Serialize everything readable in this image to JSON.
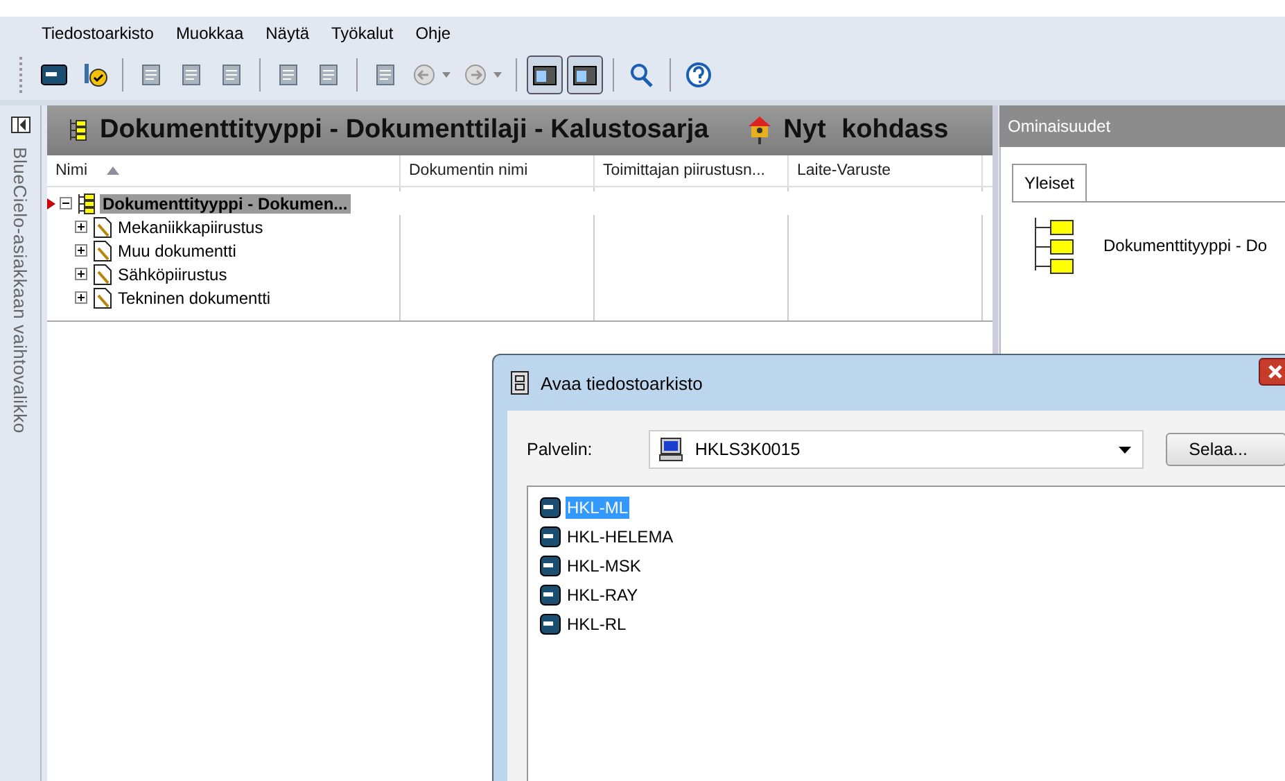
{
  "menu": [
    "Tiedostoarkisto",
    "Muokkaa",
    "Näytä",
    "Työkalut",
    "Ohje"
  ],
  "toolbar": [
    [
      {
        "pressed": false,
        "dropdown": false
      },
      {
        "pressed": false,
        "dropdown": false
      }
    ],
    [
      {
        "pressed": false,
        "dropdown": false
      },
      {
        "pressed": false,
        "dropdown": false
      },
      {
        "pressed": false,
        "dropdown": false
      }
    ],
    [
      {
        "pressed": false,
        "dropdown": false
      },
      {
        "pressed": false,
        "dropdown": false
      }
    ],
    [
      {
        "pressed": false,
        "dropdown": false
      },
      {
        "pressed": false,
        "dropdown": true
      },
      {
        "pressed": false,
        "dropdown": true
      }
    ],
    [
      {
        "pressed": true,
        "dropdown": false
      },
      {
        "pressed": true,
        "dropdown": false
      }
    ],
    [
      {
        "pressed": false,
        "dropdown": false
      }
    ],
    [
      {
        "pressed": false,
        "dropdown": false
      }
    ]
  ],
  "side_tab": "BlueCielo-asiakkaan vaihtovalikko",
  "header": {
    "title": "Dokumenttityyppi - Dokumenttilaji - Kalustosarja",
    "location": "Nyt kohdass"
  },
  "columns": [
    {
      "label": "Nimi",
      "sorted": true
    },
    {
      "label": "Dokumentin nimi",
      "sorted": false
    },
    {
      "label": "Toimittajan piirustusn...",
      "sorted": false
    },
    {
      "label": "Laite-Varuste",
      "sorted": false
    }
  ],
  "tree": {
    "label": "Dokumenttityyppi - Dokumen...",
    "expanded": true,
    "selected": true,
    "children": [
      {
        "label": "Mekaniikkapiirustus",
        "expanded": false
      },
      {
        "label": "Muu dokumentti",
        "expanded": false
      },
      {
        "label": "Sähköpiirustus",
        "expanded": false
      },
      {
        "label": "Tekninen dokumentti",
        "expanded": false
      }
    ]
  },
  "properties": {
    "title": "Ominaisuudet",
    "tabs": [
      {
        "label": "Yleiset",
        "selected": true
      }
    ],
    "name": "Dokumenttityyppi - Do"
  },
  "dialog": {
    "title": "Avaa tiedostoarkisto",
    "server_label": "Palvelin:",
    "server": "HKLS3K0015",
    "browse": "Selaa...",
    "archives": [
      {
        "label": "HKL-ML",
        "selected": true
      },
      {
        "label": "HKL-HELEMA",
        "selected": false
      },
      {
        "label": "HKL-MSK",
        "selected": false
      },
      {
        "label": "HKL-RAY",
        "selected": false
      },
      {
        "label": "HKL-RL",
        "selected": false
      }
    ]
  }
}
